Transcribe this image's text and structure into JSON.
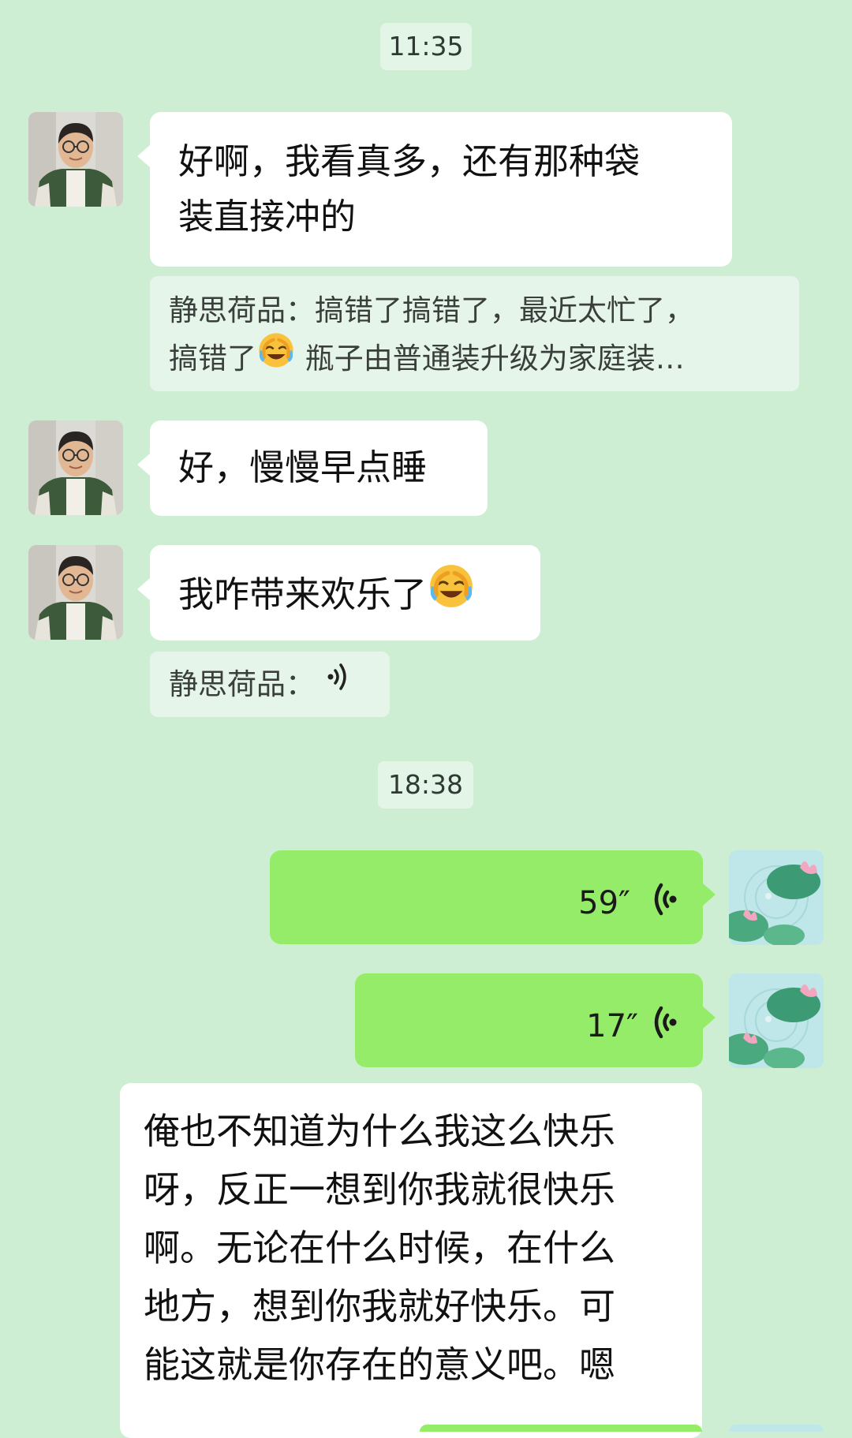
{
  "time_1": "11:35",
  "time_2": "18:38",
  "msg_1": {
    "line_1": "好啊，我看真多，还有那种袋",
    "line_2": "装直接冲的"
  },
  "quote_1": {
    "line_1": "静思荷品：搞错了搞错了，最近太忙了，",
    "line_2_a": "搞错了",
    "line_2_b": " 瓶子由普通装升级为家庭装…"
  },
  "msg_2": "好，慢慢早点睡",
  "msg_3": "我咋带来欢乐了",
  "quote_2": "静思荷品：",
  "voice_1": "59″",
  "voice_2": "17″",
  "msg_4": {
    "line_1": "俺也不知道为什么我这么快乐",
    "line_2": "呀，反正一想到你我就很快乐",
    "line_3": "啊。无论在什么时候，在什么",
    "line_4": "地方，想到你我就好快乐。可",
    "line_5": "能这就是你存在的意义吧。嗯"
  },
  "icons": {
    "emoji": "crying-laughing-emoji",
    "voice": "voice-wave-icon"
  },
  "colors": {
    "background": "#cdeed3",
    "bubble_in": "#ffffff",
    "bubble_out": "#95ec69",
    "quote_bg": "#e6f5e9",
    "time_bg": "#e3f5e6"
  }
}
